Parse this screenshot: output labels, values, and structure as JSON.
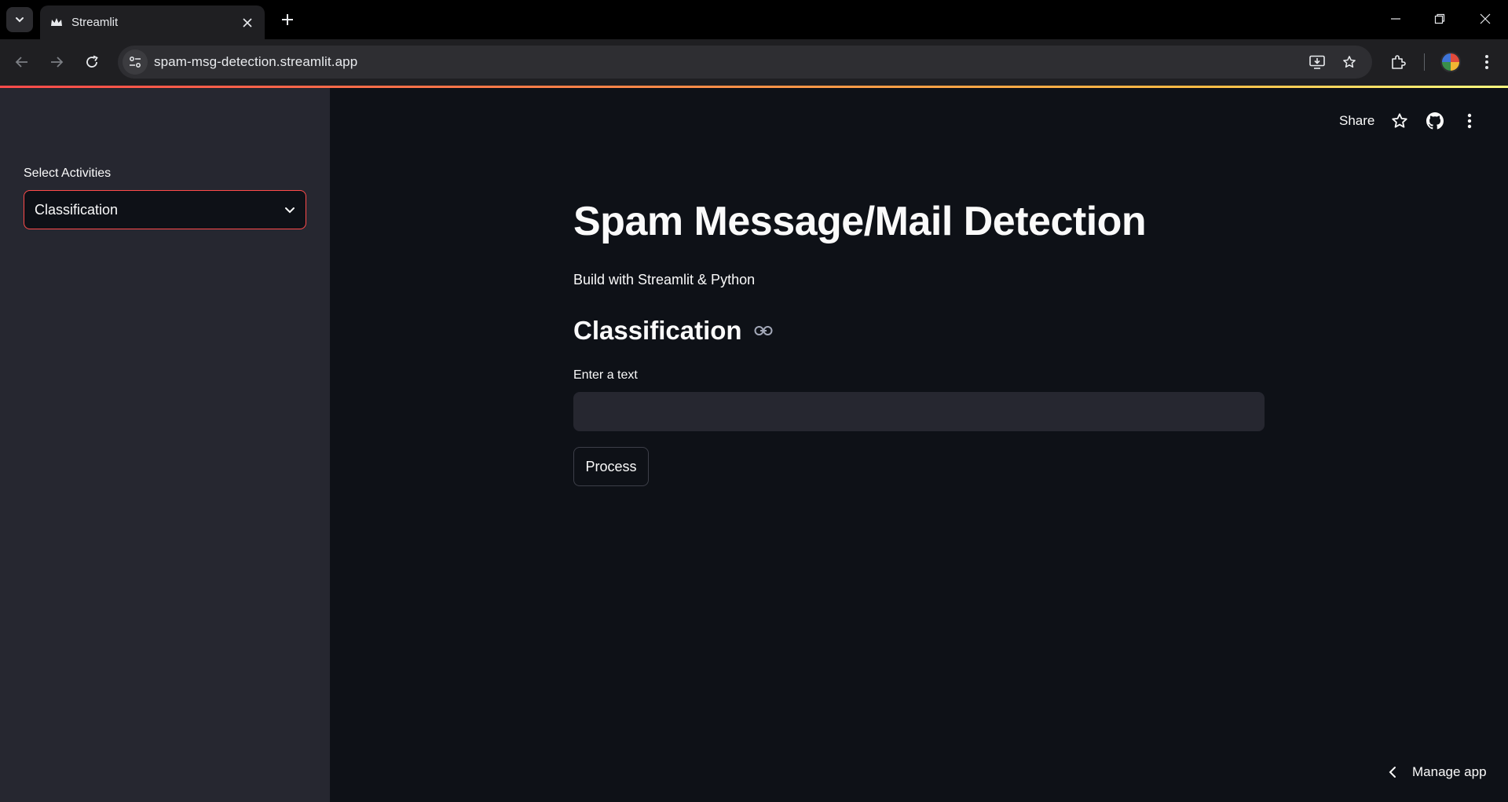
{
  "browser": {
    "tab_title": "Streamlit",
    "url": "spam-msg-detection.streamlit.app"
  },
  "sidebar": {
    "select_label": "Select Activities",
    "select_value": "Classification"
  },
  "header": {
    "share_label": "Share"
  },
  "main": {
    "title": "Spam Message/Mail Detection",
    "subtitle": "Build with Streamlit & Python",
    "section_heading": "Classification",
    "input_label": "Enter a text",
    "input_value": "",
    "process_label": "Process"
  },
  "footer": {
    "manage_label": "Manage app"
  },
  "colors": {
    "primary": "#ff4b4b",
    "background": "#0e1117",
    "sidebar_background": "#262730",
    "text": "#fafafa"
  }
}
